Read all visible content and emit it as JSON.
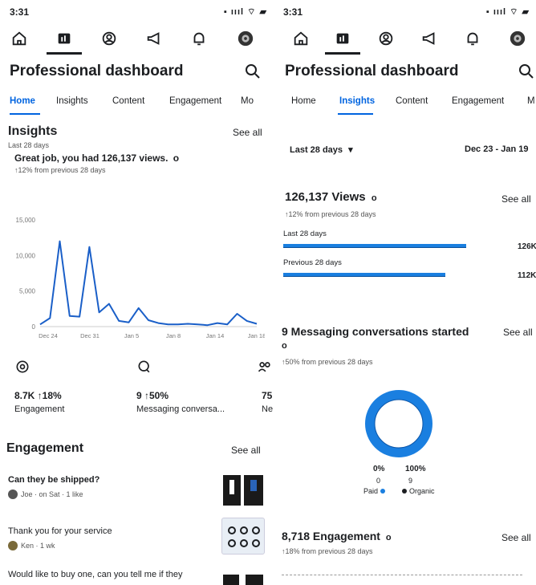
{
  "left": {
    "status": {
      "time": "3:31",
      "sys": "▪ ıııl ⌔ ▰"
    },
    "title": "Professional dashboard",
    "tabs": [
      "Home",
      "Insights",
      "Content",
      "Engagement",
      "Mo"
    ],
    "insights": {
      "title": "Insights",
      "see_all": "See all",
      "period": "Last 28 days",
      "headline": "Great job, you had 126,137 views.",
      "info_glyph": "o",
      "delta": "↑12% from previous 28 days"
    },
    "chart_data": {
      "type": "line",
      "x": [
        "Dec 24",
        "Dec 31",
        "Jan 5",
        "Jan 8",
        "Jan 14",
        "Jan 18"
      ],
      "y_ticks": [
        "15,000",
        "10,000",
        "5,000",
        "0"
      ],
      "ylim": [
        0,
        15000
      ],
      "series": [
        {
          "values": [
            300,
            1200,
            12000,
            1500,
            1400,
            11200,
            2000,
            3200,
            800,
            600,
            2600,
            900,
            500,
            300,
            300,
            400,
            300,
            200,
            500,
            300,
            1800,
            800,
            400
          ]
        }
      ],
      "color": "#1a5fc8"
    },
    "metrics": [
      {
        "icon": "engagement-icon",
        "value": "8.7K ↑18%",
        "label": "Engagement"
      },
      {
        "icon": "messaging-icon",
        "value": "9 ↑50%",
        "label": "Messaging conversa..."
      },
      {
        "icon": "people-icon",
        "value": "75",
        "label": "Ne"
      }
    ],
    "engagement": {
      "title": "Engagement",
      "see_all": "See all",
      "items": [
        {
          "question": "Can they be shipped?",
          "meta": "Joe · on Sat · 1 like"
        },
        {
          "question": "Thank you for your service",
          "meta": "Ken · 1 wk"
        },
        {
          "question": "Would like to buy one, can you tell me if they",
          "meta": ""
        }
      ]
    }
  },
  "right": {
    "status": {
      "time": "3:31",
      "sys": "▪ ıııl ⌔ ▰"
    },
    "title": "Professional dashboard",
    "tabs": [
      "Home",
      "Insights",
      "Content",
      "Engagement",
      "M"
    ],
    "filter": {
      "period": "Last 28 days",
      "caret": "▾",
      "range": "Dec 23 - Jan 19"
    },
    "views": {
      "title": "126,137 Views",
      "info_glyph": "o",
      "see_all": "See all",
      "delta": "↑12% from previous 28 days",
      "bars": [
        {
          "label": "Last 28 days",
          "value_text": "126K",
          "value": 126137
        },
        {
          "label": "Previous 28 days",
          "value_text": "112K",
          "value": 112000
        }
      ]
    },
    "messaging": {
      "title": "9 Messaging conversations started",
      "info_glyph": "o",
      "see_all": "See all",
      "delta": "↑50% from previous 28 days",
      "donut": {
        "paid_pct": "0%",
        "organic_pct": "100%",
        "paid_count": "0",
        "organic_count": "9",
        "paid_label": "Paid",
        "organic_label": "Organic",
        "paid_fraction": 0,
        "organic_fraction": 1,
        "ring_color": "#1a7fe0",
        "ring_dark": "#0b55a8"
      }
    },
    "engagement": {
      "title": "8,718 Engagement",
      "info_glyph": "o",
      "see_all": "See all",
      "delta": "↑18% from previous 28 days"
    }
  }
}
